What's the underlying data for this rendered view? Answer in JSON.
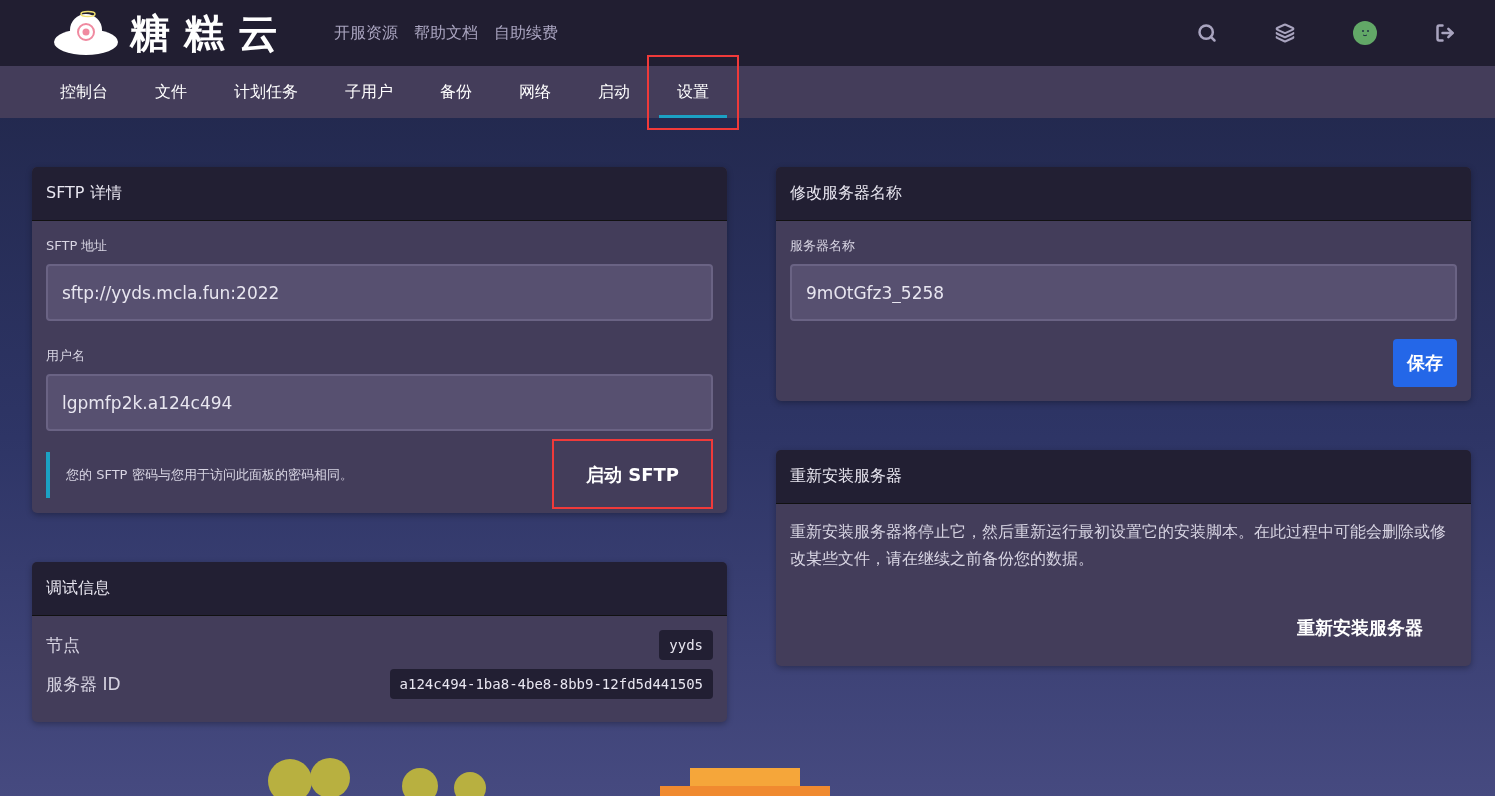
{
  "header": {
    "logo_text": "糖糕云",
    "links": [
      "开服资源",
      "帮助文档",
      "自助续费"
    ]
  },
  "tabs": [
    {
      "label": "控制台",
      "selected": false,
      "highlighted": false
    },
    {
      "label": "文件",
      "selected": false,
      "highlighted": false
    },
    {
      "label": "计划任务",
      "selected": false,
      "highlighted": false
    },
    {
      "label": "子用户",
      "selected": false,
      "highlighted": false
    },
    {
      "label": "备份",
      "selected": false,
      "highlighted": false
    },
    {
      "label": "网络",
      "selected": false,
      "highlighted": false
    },
    {
      "label": "启动",
      "selected": false,
      "highlighted": false
    },
    {
      "label": "设置",
      "selected": true,
      "highlighted": true
    }
  ],
  "sftp": {
    "title": "SFTP 详情",
    "fields": [
      {
        "label": "SFTP 地址",
        "value": "sftp://yyds.mcla.fun:2022"
      },
      {
        "label": "用户名",
        "value": "lgpmfp2k.a124c494"
      }
    ],
    "note": "您的 SFTP 密码与您用于访问此面板的密码相同。",
    "button": {
      "label": "启动 SFTP",
      "highlighted": true
    }
  },
  "debug": {
    "title": "调试信息",
    "rows": [
      {
        "label": "节点",
        "value": "yyds"
      },
      {
        "label": "服务器 ID",
        "value": "a124c494-1ba8-4be8-8bb9-12fd5d441505"
      }
    ]
  },
  "rename": {
    "title": "修改服务器名称",
    "field": {
      "label": "服务器名称",
      "value": "9mOtGfz3_5258"
    },
    "button": "保存"
  },
  "reinstall": {
    "title": "重新安装服务器",
    "text": "重新安装服务器将停止它，然后重新运行最初设置它的安装脚本。在此过程中可能会删除或修改某些文件，请在继续之前备份您的数据。",
    "button": "重新安装服务器"
  }
}
